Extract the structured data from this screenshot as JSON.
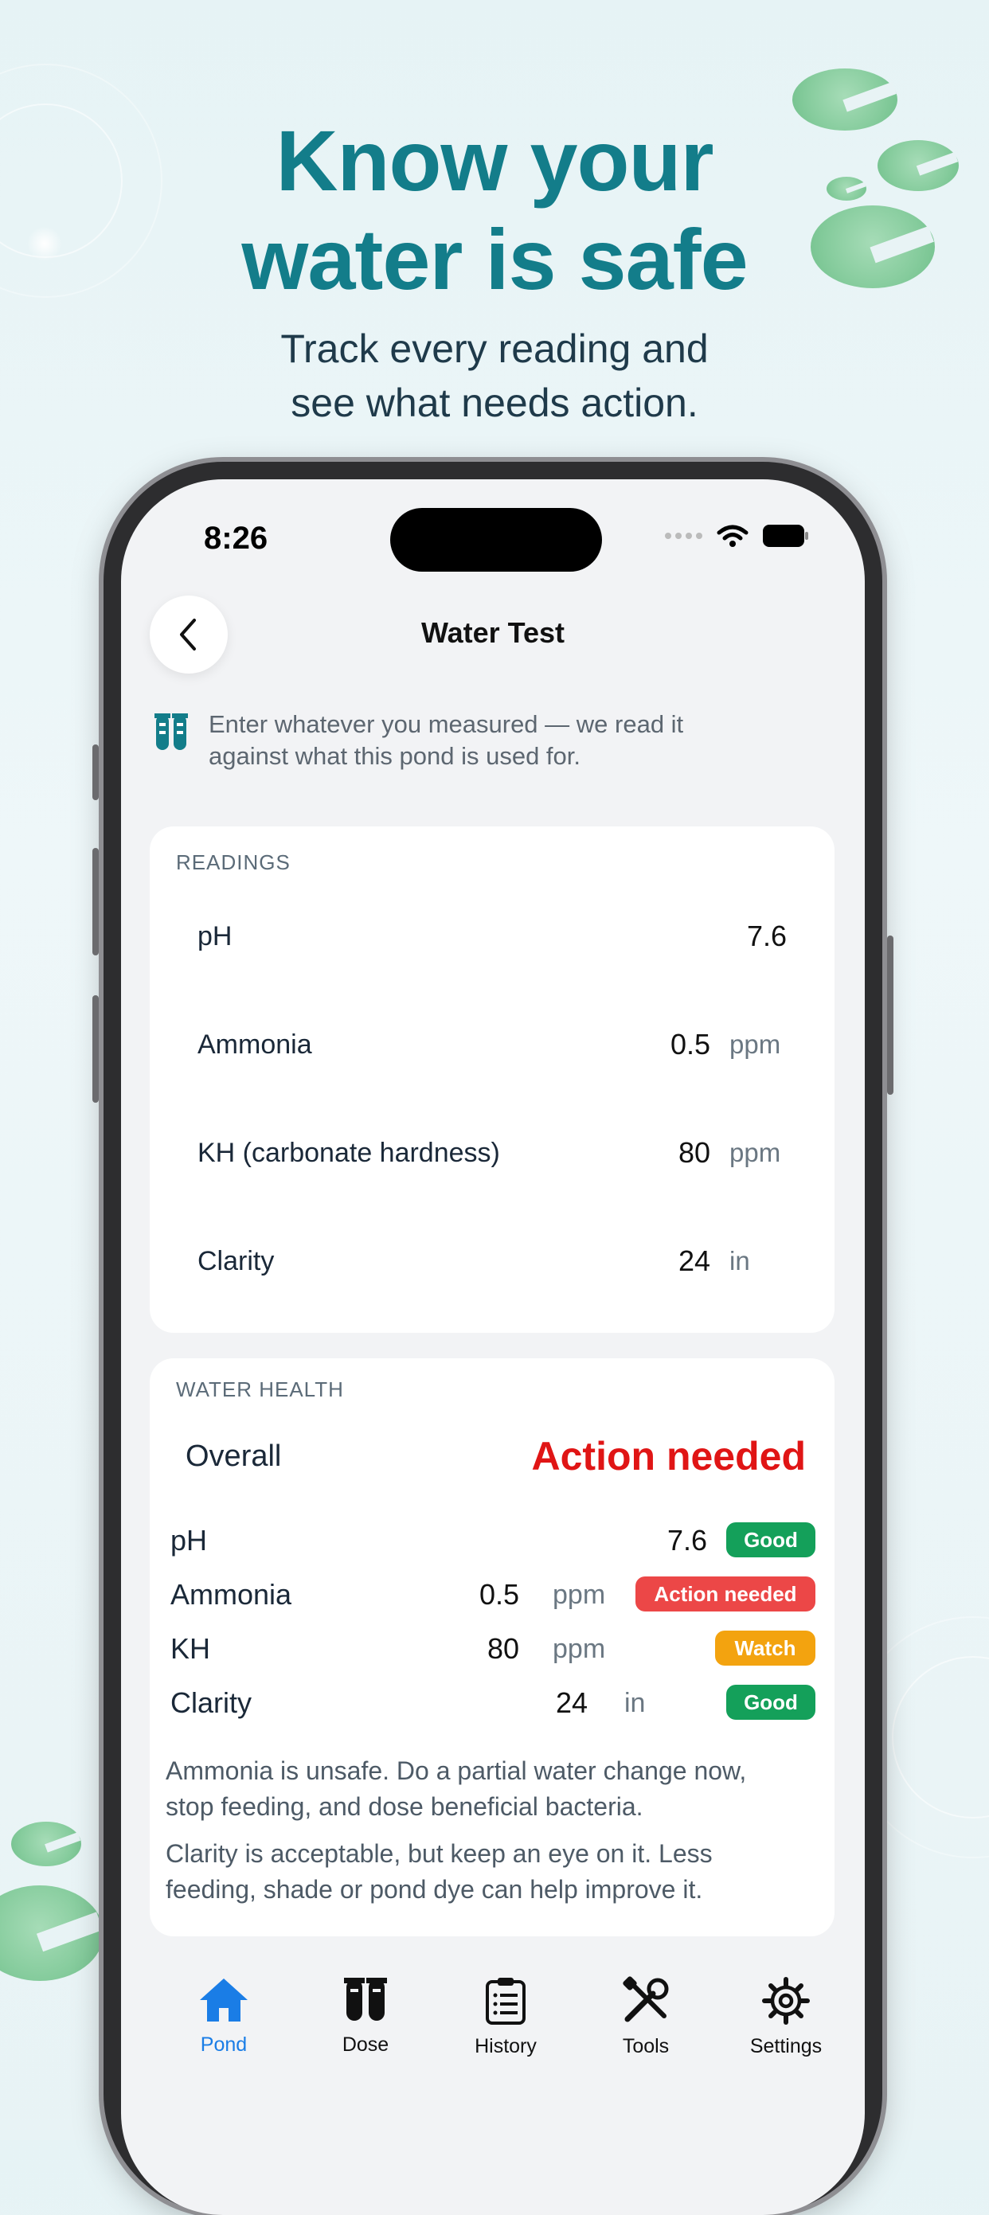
{
  "hero": {
    "title_line1": "Know your",
    "title_line2": "water is safe",
    "subtitle_line1": "Track every reading and",
    "subtitle_line2": "see what needs action."
  },
  "status_bar": {
    "time": "8:26"
  },
  "nav": {
    "title": "Water Test",
    "back_icon": "chevron-left-icon"
  },
  "info": {
    "icon": "test-tubes-icon",
    "text_line1": "Enter whatever you measured — we read it",
    "text_line2": "against what this pond is used for."
  },
  "readings": {
    "label": "READINGS",
    "items": [
      {
        "name": "pH",
        "value": "7.6",
        "unit": ""
      },
      {
        "name": "Ammonia",
        "value": "0.5",
        "unit": "ppm"
      },
      {
        "name": "KH (carbonate hardness)",
        "value": "80",
        "unit": "ppm"
      },
      {
        "name": "Clarity",
        "value": "24",
        "unit": "in"
      }
    ]
  },
  "health": {
    "label": "WATER HEALTH",
    "overall_label": "Overall",
    "overall_value": "Action needed",
    "items": [
      {
        "name": "pH",
        "value": "7.6",
        "unit": "",
        "status": "Good",
        "status_color": "#14a05a"
      },
      {
        "name": "Ammonia",
        "value": "0.5",
        "unit": "ppm",
        "status": "Action needed",
        "status_color": "#ec4747"
      },
      {
        "name": "KH",
        "value": "80",
        "unit": "ppm",
        "status": "Watch",
        "status_color": "#f3a30f"
      },
      {
        "name": "Clarity",
        "value": "24",
        "unit": "in",
        "status": "Good",
        "status_color": "#14a05a"
      }
    ],
    "note1_line1": "Ammonia is unsafe. Do a partial water change now,",
    "note1_line2": "stop feeding, and dose beneficial bacteria.",
    "note2_line1": "Clarity is acceptable, but keep an eye on it. Less",
    "note2_line2": "feeding, shade or pond dye can help improve it."
  },
  "tabbar": {
    "items": [
      {
        "label": "Pond",
        "icon": "home-icon",
        "active": true
      },
      {
        "label": "Dose",
        "icon": "test-tubes-icon",
        "active": false
      },
      {
        "label": "History",
        "icon": "clipboard-icon",
        "active": false
      },
      {
        "label": "Tools",
        "icon": "tools-icon",
        "active": false
      },
      {
        "label": "Settings",
        "icon": "gear-icon",
        "active": false
      }
    ]
  },
  "colors": {
    "accent_teal": "#137d8a",
    "danger": "#e01515",
    "active_tab": "#1a7de6"
  }
}
